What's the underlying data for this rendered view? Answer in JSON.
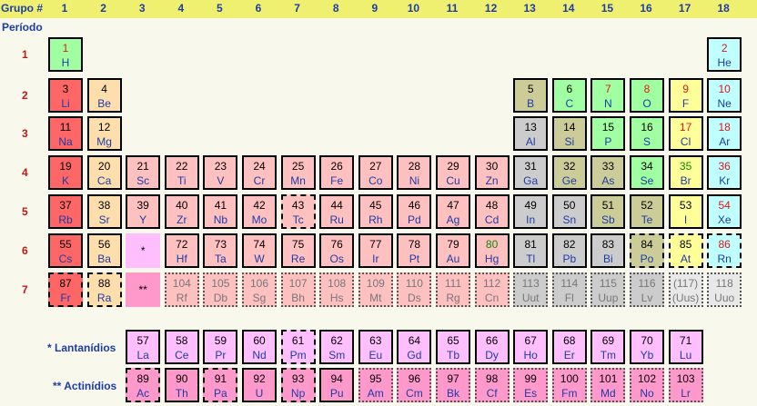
{
  "header": {
    "group_label": "Grupo #",
    "period_label": "Período",
    "groups": [
      "1",
      "2",
      "3",
      "4",
      "5",
      "6",
      "7",
      "8",
      "9",
      "10",
      "11",
      "12",
      "13",
      "14",
      "15",
      "16",
      "17",
      "18"
    ],
    "periods": [
      "1",
      "2",
      "3",
      "4",
      "5",
      "6",
      "7"
    ]
  },
  "series_labels": {
    "lanthanides": "* Lantanídios",
    "actinides": "** Actinídios"
  },
  "placeholders": {
    "lanthanide": "*",
    "actinide": "**"
  },
  "colors": {
    "alkali": "#ff6666",
    "alkaline": "#ffdead",
    "transition": "#ffc0c0",
    "post": "#cccccc",
    "metalloid": "#cccc99",
    "nonmetal": "#a0ffa0",
    "halogen": "#ffff99",
    "noble": "#c0ffff",
    "lanthanide": "#ffbfff",
    "actinide": "#ff99cc",
    "unknown": "#e8e8e8"
  },
  "elements": [
    {
      "n": "1",
      "s": "H",
      "p": 1,
      "g": 1,
      "c": "nonmetal",
      "st": "gas"
    },
    {
      "n": "2",
      "s": "He",
      "p": 1,
      "g": 18,
      "c": "noble",
      "st": "gas"
    },
    {
      "n": "3",
      "s": "Li",
      "p": 2,
      "g": 1,
      "c": "alkali"
    },
    {
      "n": "4",
      "s": "Be",
      "p": 2,
      "g": 2,
      "c": "alkaline"
    },
    {
      "n": "5",
      "s": "B",
      "p": 2,
      "g": 13,
      "c": "metalloid"
    },
    {
      "n": "6",
      "s": "C",
      "p": 2,
      "g": 14,
      "c": "nonmetal"
    },
    {
      "n": "7",
      "s": "N",
      "p": 2,
      "g": 15,
      "c": "nonmetal",
      "st": "gas"
    },
    {
      "n": "8",
      "s": "O",
      "p": 2,
      "g": 16,
      "c": "nonmetal",
      "st": "gas"
    },
    {
      "n": "9",
      "s": "F",
      "p": 2,
      "g": 17,
      "c": "halogen",
      "st": "gas"
    },
    {
      "n": "10",
      "s": "Ne",
      "p": 2,
      "g": 18,
      "c": "noble",
      "st": "gas"
    },
    {
      "n": "11",
      "s": "Na",
      "p": 3,
      "g": 1,
      "c": "alkali"
    },
    {
      "n": "12",
      "s": "Mg",
      "p": 3,
      "g": 2,
      "c": "alkaline"
    },
    {
      "n": "13",
      "s": "Al",
      "p": 3,
      "g": 13,
      "c": "post"
    },
    {
      "n": "14",
      "s": "Si",
      "p": 3,
      "g": 14,
      "c": "metalloid"
    },
    {
      "n": "15",
      "s": "P",
      "p": 3,
      "g": 15,
      "c": "nonmetal"
    },
    {
      "n": "16",
      "s": "S",
      "p": 3,
      "g": 16,
      "c": "nonmetal"
    },
    {
      "n": "17",
      "s": "Cl",
      "p": 3,
      "g": 17,
      "c": "halogen",
      "st": "gas"
    },
    {
      "n": "18",
      "s": "Ar",
      "p": 3,
      "g": 18,
      "c": "noble",
      "st": "gas"
    },
    {
      "n": "19",
      "s": "K",
      "p": 4,
      "g": 1,
      "c": "alkali"
    },
    {
      "n": "20",
      "s": "Ca",
      "p": 4,
      "g": 2,
      "c": "alkaline"
    },
    {
      "n": "21",
      "s": "Sc",
      "p": 4,
      "g": 3,
      "c": "transition"
    },
    {
      "n": "22",
      "s": "Ti",
      "p": 4,
      "g": 4,
      "c": "transition"
    },
    {
      "n": "23",
      "s": "V",
      "p": 4,
      "g": 5,
      "c": "transition"
    },
    {
      "n": "24",
      "s": "Cr",
      "p": 4,
      "g": 6,
      "c": "transition"
    },
    {
      "n": "25",
      "s": "Mn",
      "p": 4,
      "g": 7,
      "c": "transition"
    },
    {
      "n": "26",
      "s": "Fe",
      "p": 4,
      "g": 8,
      "c": "transition"
    },
    {
      "n": "27",
      "s": "Co",
      "p": 4,
      "g": 9,
      "c": "transition"
    },
    {
      "n": "28",
      "s": "Ni",
      "p": 4,
      "g": 10,
      "c": "transition"
    },
    {
      "n": "29",
      "s": "Cu",
      "p": 4,
      "g": 11,
      "c": "transition"
    },
    {
      "n": "30",
      "s": "Zn",
      "p": 4,
      "g": 12,
      "c": "transition"
    },
    {
      "n": "31",
      "s": "Ga",
      "p": 4,
      "g": 13,
      "c": "post"
    },
    {
      "n": "32",
      "s": "Ge",
      "p": 4,
      "g": 14,
      "c": "metalloid"
    },
    {
      "n": "33",
      "s": "As",
      "p": 4,
      "g": 15,
      "c": "metalloid"
    },
    {
      "n": "34",
      "s": "Se",
      "p": 4,
      "g": 16,
      "c": "nonmetal"
    },
    {
      "n": "35",
      "s": "Br",
      "p": 4,
      "g": 17,
      "c": "halogen",
      "st": "liq"
    },
    {
      "n": "36",
      "s": "Kr",
      "p": 4,
      "g": 18,
      "c": "noble",
      "st": "gas"
    },
    {
      "n": "37",
      "s": "Rb",
      "p": 5,
      "g": 1,
      "c": "alkali"
    },
    {
      "n": "38",
      "s": "Sr",
      "p": 5,
      "g": 2,
      "c": "alkaline"
    },
    {
      "n": "39",
      "s": "Y",
      "p": 5,
      "g": 3,
      "c": "transition"
    },
    {
      "n": "40",
      "s": "Zr",
      "p": 5,
      "g": 4,
      "c": "transition"
    },
    {
      "n": "41",
      "s": "Nb",
      "p": 5,
      "g": 5,
      "c": "transition"
    },
    {
      "n": "42",
      "s": "Mo",
      "p": 5,
      "g": 6,
      "c": "transition"
    },
    {
      "n": "43",
      "s": "Tc",
      "p": 5,
      "g": 7,
      "c": "transition",
      "b": "dash"
    },
    {
      "n": "44",
      "s": "Ru",
      "p": 5,
      "g": 8,
      "c": "transition"
    },
    {
      "n": "45",
      "s": "Rh",
      "p": 5,
      "g": 9,
      "c": "transition"
    },
    {
      "n": "46",
      "s": "Pd",
      "p": 5,
      "g": 10,
      "c": "transition"
    },
    {
      "n": "47",
      "s": "Ag",
      "p": 5,
      "g": 11,
      "c": "transition"
    },
    {
      "n": "48",
      "s": "Cd",
      "p": 5,
      "g": 12,
      "c": "transition"
    },
    {
      "n": "49",
      "s": "In",
      "p": 5,
      "g": 13,
      "c": "post"
    },
    {
      "n": "50",
      "s": "Sn",
      "p": 5,
      "g": 14,
      "c": "post"
    },
    {
      "n": "51",
      "s": "Sb",
      "p": 5,
      "g": 15,
      "c": "metalloid"
    },
    {
      "n": "52",
      "s": "Te",
      "p": 5,
      "g": 16,
      "c": "metalloid"
    },
    {
      "n": "53",
      "s": "I",
      "p": 5,
      "g": 17,
      "c": "halogen"
    },
    {
      "n": "54",
      "s": "Xe",
      "p": 5,
      "g": 18,
      "c": "noble",
      "st": "gas"
    },
    {
      "n": "55",
      "s": "Cs",
      "p": 6,
      "g": 1,
      "c": "alkali"
    },
    {
      "n": "56",
      "s": "Ba",
      "p": 6,
      "g": 2,
      "c": "alkaline"
    },
    {
      "n": "72",
      "s": "Hf",
      "p": 6,
      "g": 4,
      "c": "transition"
    },
    {
      "n": "73",
      "s": "Ta",
      "p": 6,
      "g": 5,
      "c": "transition"
    },
    {
      "n": "74",
      "s": "W",
      "p": 6,
      "g": 6,
      "c": "transition"
    },
    {
      "n": "75",
      "s": "Re",
      "p": 6,
      "g": 7,
      "c": "transition"
    },
    {
      "n": "76",
      "s": "Os",
      "p": 6,
      "g": 8,
      "c": "transition"
    },
    {
      "n": "77",
      "s": "Ir",
      "p": 6,
      "g": 9,
      "c": "transition"
    },
    {
      "n": "78",
      "s": "Pt",
      "p": 6,
      "g": 10,
      "c": "transition"
    },
    {
      "n": "79",
      "s": "Au",
      "p": 6,
      "g": 11,
      "c": "transition"
    },
    {
      "n": "80",
      "s": "Hg",
      "p": 6,
      "g": 12,
      "c": "transition",
      "st": "liq"
    },
    {
      "n": "81",
      "s": "Tl",
      "p": 6,
      "g": 13,
      "c": "post"
    },
    {
      "n": "82",
      "s": "Pb",
      "p": 6,
      "g": 14,
      "c": "post"
    },
    {
      "n": "83",
      "s": "Bi",
      "p": 6,
      "g": 15,
      "c": "post"
    },
    {
      "n": "84",
      "s": "Po",
      "p": 6,
      "g": 16,
      "c": "metalloid",
      "b": "dash"
    },
    {
      "n": "85",
      "s": "At",
      "p": 6,
      "g": 17,
      "c": "halogen",
      "b": "dash"
    },
    {
      "n": "86",
      "s": "Rn",
      "p": 6,
      "g": 18,
      "c": "noble",
      "st": "gas",
      "b": "dash"
    },
    {
      "n": "87",
      "s": "Fr",
      "p": 7,
      "g": 1,
      "c": "alkali",
      "b": "dash"
    },
    {
      "n": "88",
      "s": "Ra",
      "p": 7,
      "g": 2,
      "c": "alkaline",
      "b": "dash"
    },
    {
      "n": "104",
      "s": "Rf",
      "p": 7,
      "g": 4,
      "c": "transition",
      "st": "unk",
      "b": "dot"
    },
    {
      "n": "105",
      "s": "Db",
      "p": 7,
      "g": 5,
      "c": "transition",
      "st": "unk",
      "b": "dot"
    },
    {
      "n": "106",
      "s": "Sg",
      "p": 7,
      "g": 6,
      "c": "transition",
      "st": "unk",
      "b": "dot"
    },
    {
      "n": "107",
      "s": "Bh",
      "p": 7,
      "g": 7,
      "c": "transition",
      "st": "unk",
      "b": "dot"
    },
    {
      "n": "108",
      "s": "Hs",
      "p": 7,
      "g": 8,
      "c": "transition",
      "st": "unk",
      "b": "dot"
    },
    {
      "n": "109",
      "s": "Mt",
      "p": 7,
      "g": 9,
      "c": "transition",
      "st": "unk",
      "b": "dot"
    },
    {
      "n": "110",
      "s": "Ds",
      "p": 7,
      "g": 10,
      "c": "transition",
      "st": "unk",
      "b": "dot"
    },
    {
      "n": "111",
      "s": "Rg",
      "p": 7,
      "g": 11,
      "c": "transition",
      "st": "unk",
      "b": "dot"
    },
    {
      "n": "112",
      "s": "Cn",
      "p": 7,
      "g": 12,
      "c": "transition",
      "st": "unk",
      "b": "dot"
    },
    {
      "n": "113",
      "s": "Uut",
      "p": 7,
      "g": 13,
      "c": "post",
      "st": "unk",
      "b": "dot"
    },
    {
      "n": "114",
      "s": "Fl",
      "p": 7,
      "g": 14,
      "c": "post",
      "st": "unk",
      "b": "dot"
    },
    {
      "n": "115",
      "s": "Uup",
      "p": 7,
      "g": 15,
      "c": "post",
      "st": "unk",
      "b": "dot"
    },
    {
      "n": "116",
      "s": "Lv",
      "p": 7,
      "g": 16,
      "c": "post",
      "st": "unk",
      "b": "dot"
    },
    {
      "n": "(117)",
      "s": "(Uus)",
      "p": 7,
      "g": 17,
      "c": "unknown",
      "st": "unk",
      "b": "dot"
    },
    {
      "n": "118",
      "s": "Uuo",
      "p": 7,
      "g": 18,
      "c": "unknown",
      "st": "unk",
      "b": "dot"
    },
    {
      "n": "57",
      "s": "La",
      "p": 8,
      "g": 3,
      "c": "lanthanide"
    },
    {
      "n": "58",
      "s": "Ce",
      "p": 8,
      "g": 4,
      "c": "lanthanide"
    },
    {
      "n": "59",
      "s": "Pr",
      "p": 8,
      "g": 5,
      "c": "lanthanide"
    },
    {
      "n": "60",
      "s": "Nd",
      "p": 8,
      "g": 6,
      "c": "lanthanide"
    },
    {
      "n": "61",
      "s": "Pm",
      "p": 8,
      "g": 7,
      "c": "lanthanide",
      "b": "dash"
    },
    {
      "n": "62",
      "s": "Sm",
      "p": 8,
      "g": 8,
      "c": "lanthanide"
    },
    {
      "n": "63",
      "s": "Eu",
      "p": 8,
      "g": 9,
      "c": "lanthanide"
    },
    {
      "n": "64",
      "s": "Gd",
      "p": 8,
      "g": 10,
      "c": "lanthanide"
    },
    {
      "n": "65",
      "s": "Tb",
      "p": 8,
      "g": 11,
      "c": "lanthanide"
    },
    {
      "n": "66",
      "s": "Dy",
      "p": 8,
      "g": 12,
      "c": "lanthanide"
    },
    {
      "n": "67",
      "s": "Ho",
      "p": 8,
      "g": 13,
      "c": "lanthanide"
    },
    {
      "n": "68",
      "s": "Er",
      "p": 8,
      "g": 14,
      "c": "lanthanide"
    },
    {
      "n": "69",
      "s": "Tm",
      "p": 8,
      "g": 15,
      "c": "lanthanide"
    },
    {
      "n": "70",
      "s": "Yb",
      "p": 8,
      "g": 16,
      "c": "lanthanide"
    },
    {
      "n": "71",
      "s": "Lu",
      "p": 8,
      "g": 17,
      "c": "lanthanide"
    },
    {
      "n": "89",
      "s": "Ac",
      "p": 9,
      "g": 3,
      "c": "actinide",
      "b": "dash"
    },
    {
      "n": "90",
      "s": "Th",
      "p": 9,
      "g": 4,
      "c": "actinide"
    },
    {
      "n": "91",
      "s": "Pa",
      "p": 9,
      "g": 5,
      "c": "actinide",
      "b": "dash"
    },
    {
      "n": "92",
      "s": "U",
      "p": 9,
      "g": 6,
      "c": "actinide"
    },
    {
      "n": "93",
      "s": "Np",
      "p": 9,
      "g": 7,
      "c": "actinide",
      "b": "dash"
    },
    {
      "n": "94",
      "s": "Pu",
      "p": 9,
      "g": 8,
      "c": "actinide"
    },
    {
      "n": "95",
      "s": "Am",
      "p": 9,
      "g": 9,
      "c": "actinide",
      "b": "dot"
    },
    {
      "n": "96",
      "s": "Cm",
      "p": 9,
      "g": 10,
      "c": "actinide",
      "b": "dot"
    },
    {
      "n": "97",
      "s": "Bk",
      "p": 9,
      "g": 11,
      "c": "actinide",
      "b": "dot"
    },
    {
      "n": "98",
      "s": "Cf",
      "p": 9,
      "g": 12,
      "c": "actinide",
      "b": "dot"
    },
    {
      "n": "99",
      "s": "Es",
      "p": 9,
      "g": 13,
      "c": "actinide",
      "b": "dot"
    },
    {
      "n": "100",
      "s": "Fm",
      "p": 9,
      "g": 14,
      "c": "actinide",
      "b": "dot"
    },
    {
      "n": "101",
      "s": "Md",
      "p": 9,
      "g": 15,
      "c": "actinide",
      "b": "dot"
    },
    {
      "n": "102",
      "s": "No",
      "p": 9,
      "g": 16,
      "c": "actinide",
      "b": "dot"
    },
    {
      "n": "103",
      "s": "Lr",
      "p": 9,
      "g": 17,
      "c": "actinide",
      "b": "dot"
    }
  ]
}
